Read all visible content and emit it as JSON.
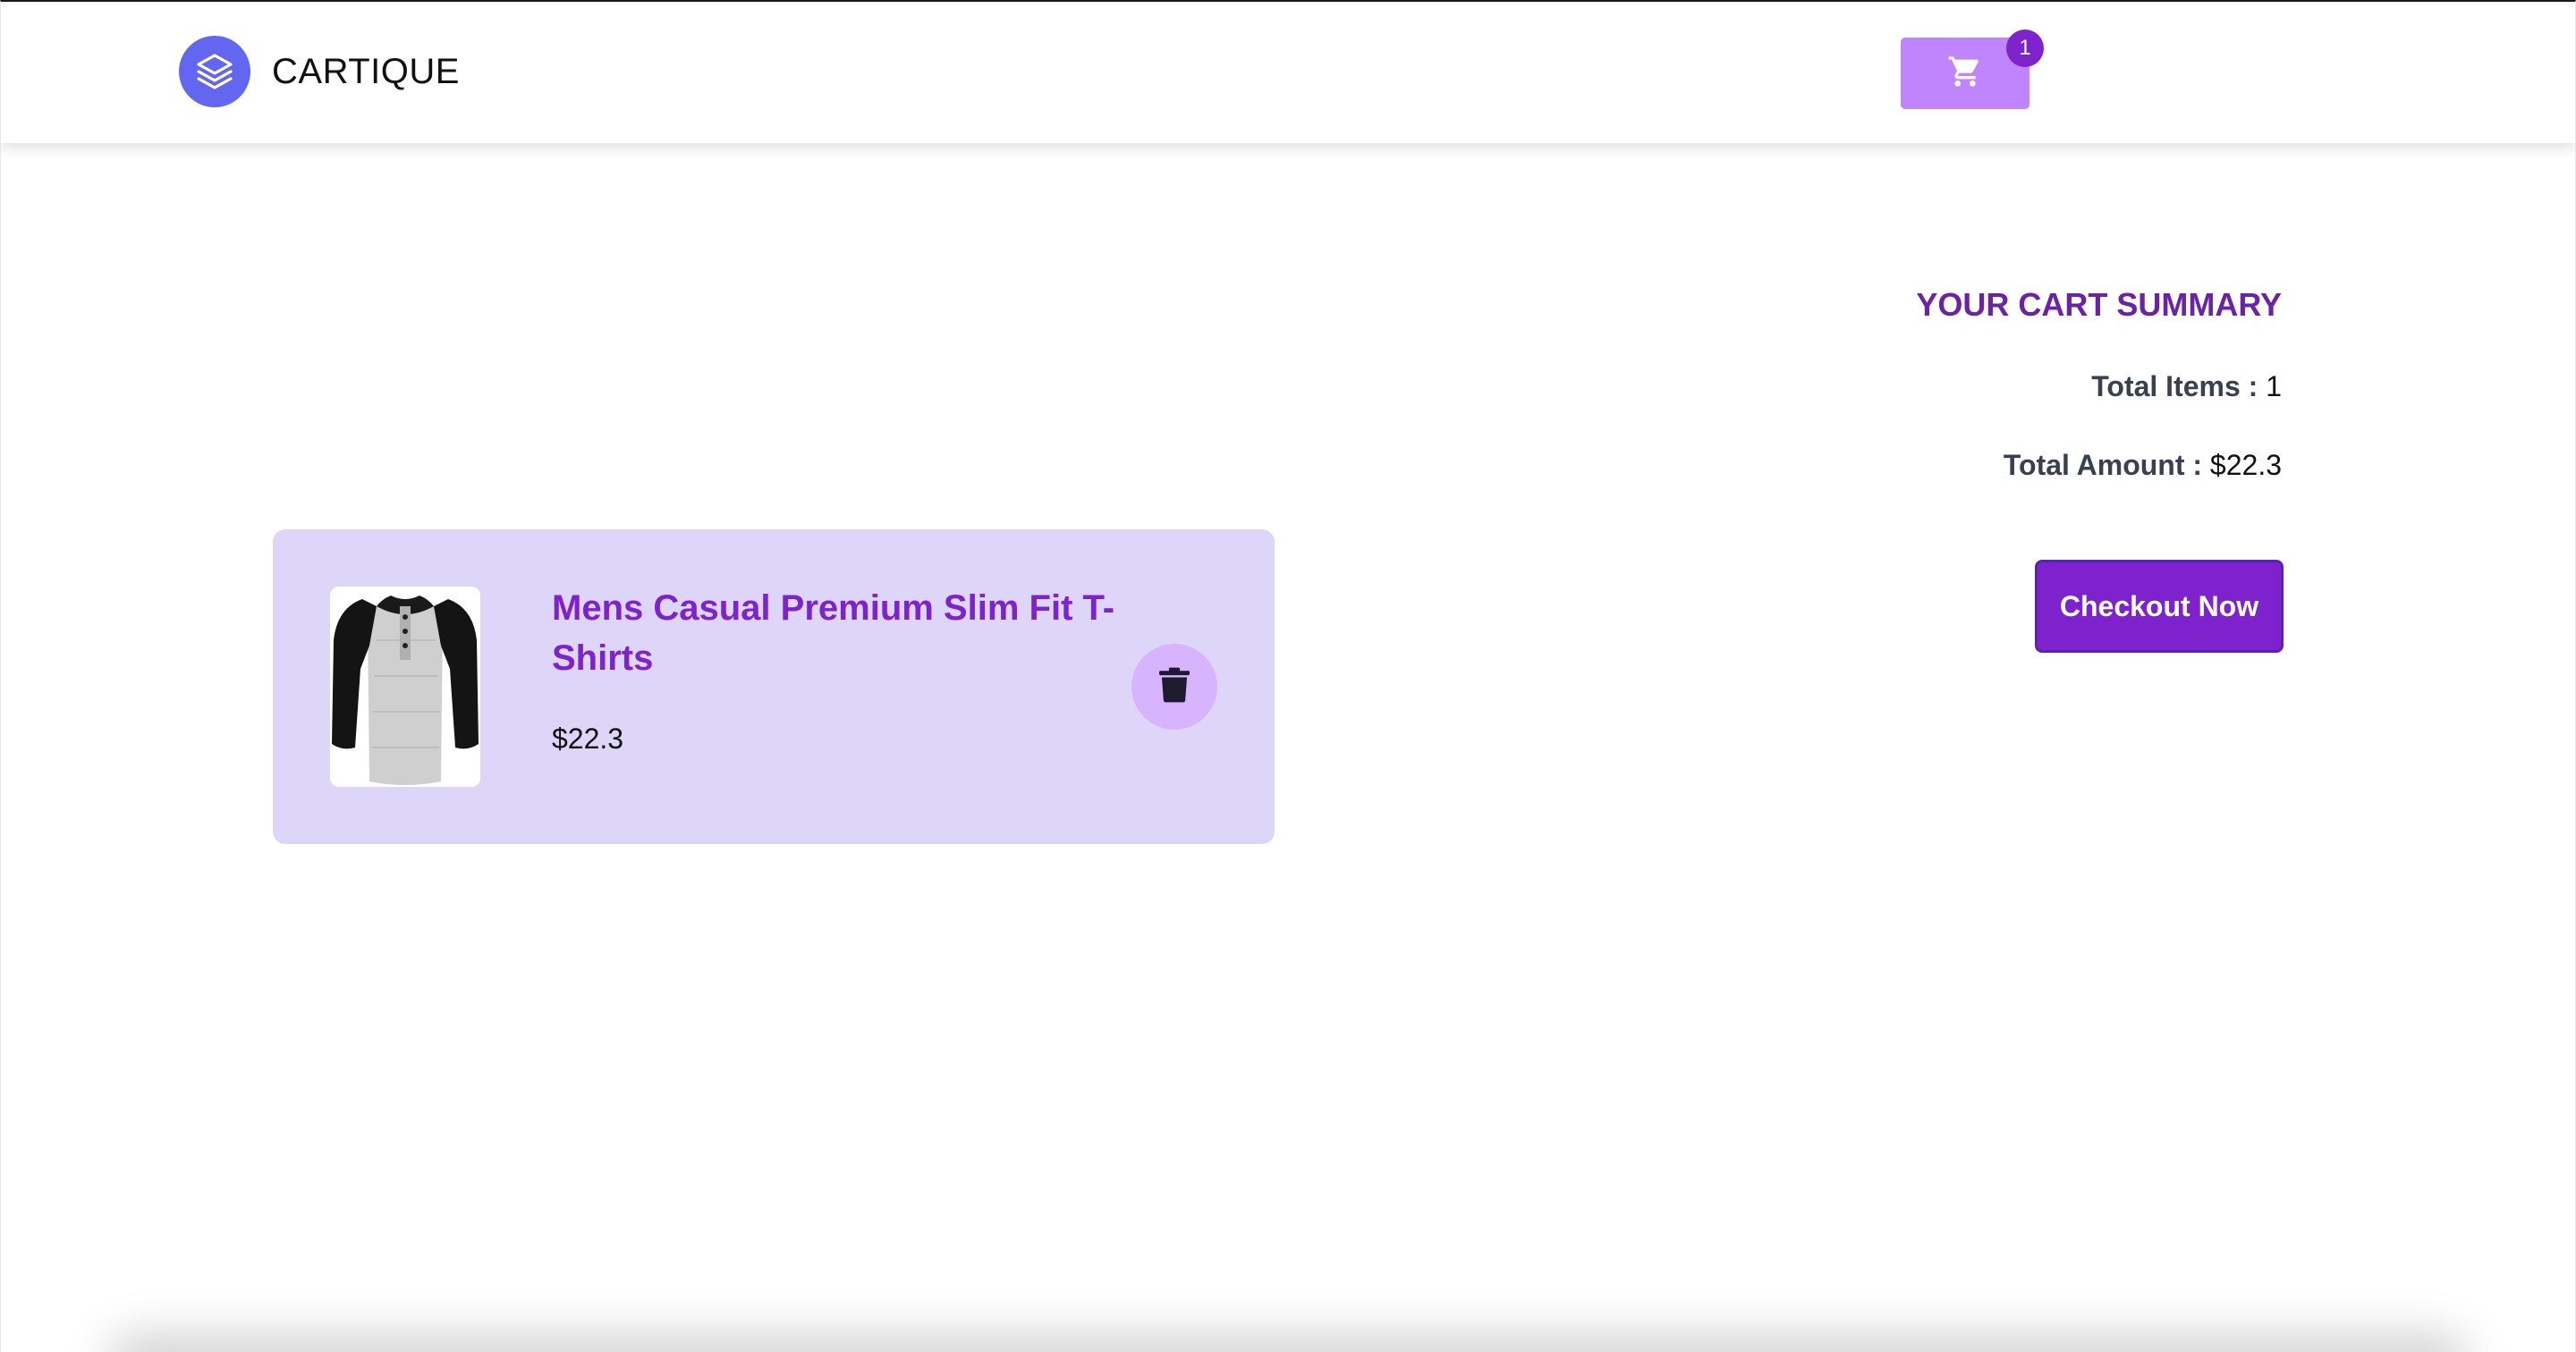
{
  "header": {
    "brand_name": "CARTIQUE",
    "logo_icon": "layers-icon",
    "cart_icon": "shopping-cart-icon",
    "cart_count": "1"
  },
  "cart_items": [
    {
      "title": "Mens Casual Premium Slim Fit T-Shirts",
      "price": "$22.3",
      "image_icon": "raglan-henley-shirt-image",
      "delete_icon": "trash-icon"
    }
  ],
  "summary": {
    "title": "YOUR CART SUMMARY",
    "total_items_label": "Total Items :",
    "total_items_value": "1",
    "total_amount_label": "Total Amount :",
    "total_amount_value": "$22.3",
    "checkout_label": "Checkout Now"
  },
  "colors": {
    "accent_purple": "#7e22ce",
    "cart_button": "#c084fc",
    "card_background": "#ddd6f8",
    "logo_background": "#6366f1",
    "delete_button": "#d8b4fe"
  }
}
